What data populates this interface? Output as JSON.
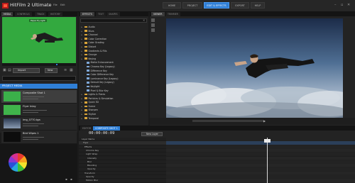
{
  "app": {
    "title": "HitFilm 2 Ultimate"
  },
  "menu": [
    "File",
    "Edit"
  ],
  "nav": [
    {
      "label": "HOME",
      "active": false
    },
    {
      "label": "PROJECT",
      "active": false
    },
    {
      "label": "EDIT & EFFECTS",
      "active": true
    },
    {
      "label": "EXPORT",
      "active": false
    },
    {
      "label": "HELP",
      "active": false
    }
  ],
  "media": {
    "tabs": [
      "MEDIA",
      "CONTROLS",
      "TRACK",
      "HISTORY"
    ],
    "preview_label": "Paper-fly-light",
    "import_label": "Import",
    "new_label": "New",
    "project_media_label": "PROJECT MEDIA",
    "items": [
      {
        "name": "Composite Shot 1",
        "selected": true
      },
      {
        "name": "Flyer Inlay",
        "selected": false
      },
      {
        "name": "img_0770.tga",
        "selected": false
      },
      {
        "name": "Bird Wipes 1",
        "selected": false
      }
    ]
  },
  "effects": {
    "tabs": [
      "EFFECTS",
      "TEXT",
      "SHAPES"
    ],
    "items": [
      {
        "label": "Audio",
        "sub": false
      },
      {
        "label": "Blurs",
        "sub": false
      },
      {
        "label": "Channel",
        "sub": false
      },
      {
        "label": "Color Correction",
        "sub": false
      },
      {
        "label": "Color Grading",
        "sub": false
      },
      {
        "label": "Distort",
        "sub": false
      },
      {
        "label": "Gradients & Fills",
        "sub": false
      },
      {
        "label": "Grunge",
        "sub": false
      },
      {
        "label": "Keying",
        "sub": false
      },
      {
        "label": "Matte Enhancement",
        "sub": true
      },
      {
        "label": "Chroma Key (Legacy)",
        "sub": true
      },
      {
        "label": "Difference Key",
        "sub": true
      },
      {
        "label": "Color Difference Key",
        "sub": true
      },
      {
        "label": "Luminance Key (Legacy)",
        "sub": true
      },
      {
        "label": "Demult Key (Legacy)",
        "sub": true
      },
      {
        "label": "Keylight",
        "sub": true
      },
      {
        "label": "Pixel & Blur Key",
        "sub": true
      },
      {
        "label": "Lights & Flares",
        "sub": false
      },
      {
        "label": "Particles & Simulation",
        "sub": false
      },
      {
        "label": "Quick 3D",
        "sub": false
      },
      {
        "label": "Scene",
        "sub": false
      },
      {
        "label": "Sharpen",
        "sub": false
      },
      {
        "label": "Stylize",
        "sub": false
      },
      {
        "label": "Temporal",
        "sub": false
      }
    ]
  },
  "viewer": {
    "tabs": [
      "VIEWER",
      "TRIMMER"
    ]
  },
  "editor": {
    "tabs": [
      "EDITOR",
      "COMPOSITE SHOT 1"
    ],
    "timecode": "00:00:00:09",
    "new_layer_label": "New Layer",
    "layers": [
      "Layer Name",
      "Flyer",
      "Effects",
      "Chroma Key",
      "Light Wrap",
      "Intensity",
      "Blur",
      "Blending",
      "Opacity",
      "Transform",
      "Opacity",
      "Motion Blur"
    ]
  },
  "colors": {
    "accent": "#2f7fd6",
    "green_screen": "#33a93f"
  }
}
